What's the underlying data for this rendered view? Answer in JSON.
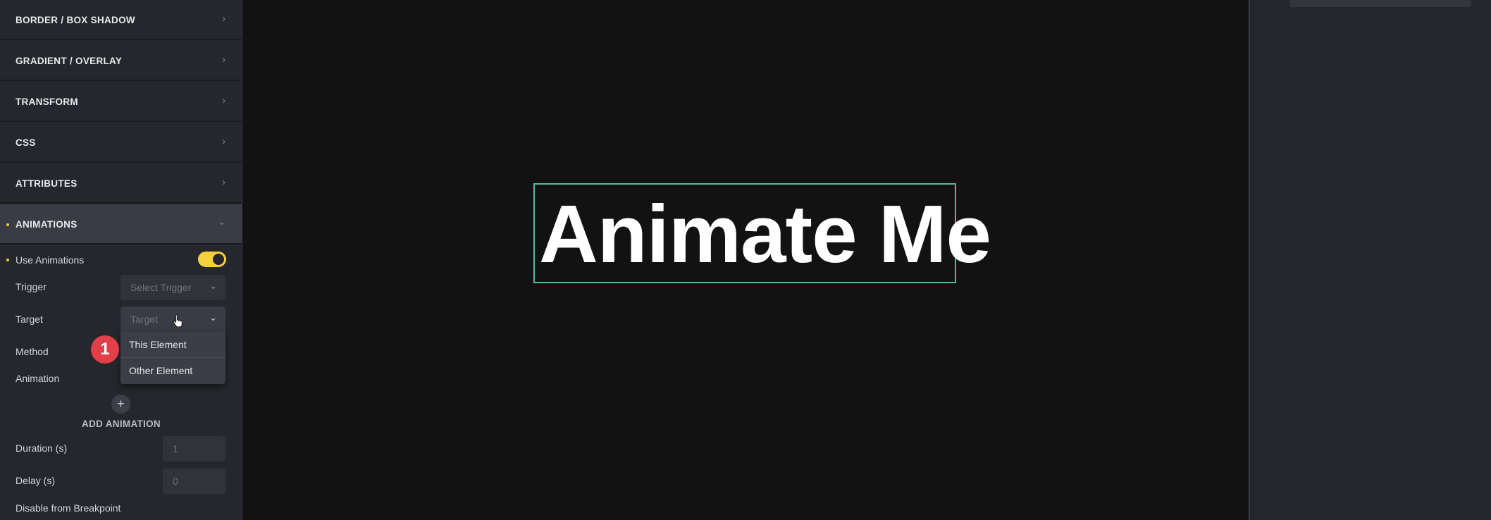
{
  "left_panel": {
    "sections": [
      {
        "label": "BORDER / BOX SHADOW",
        "icon": "chevron-right-icon"
      },
      {
        "label": "GRADIENT / OVERLAY",
        "icon": "chevron-right-icon"
      },
      {
        "label": "TRANSFORM",
        "icon": "chevron-right-icon"
      },
      {
        "label": "CSS",
        "icon": "chevron-right-icon"
      },
      {
        "label": "ATTRIBUTES",
        "icon": "chevron-right-icon"
      },
      {
        "label": "ANIMATIONS",
        "icon": "chevron-down-icon"
      }
    ],
    "animations": {
      "use_animations_label": "Use Animations",
      "use_animations_enabled": true,
      "trigger_label": "Trigger",
      "trigger_placeholder": "Select Trigger",
      "target_label": "Target",
      "target_placeholder": "Target",
      "target_options": [
        "This Element",
        "Other Element"
      ],
      "method_label": "Method",
      "animation_label": "Animation",
      "add_animation_label": "ADD ANIMATION",
      "duration_label": "Duration (s)",
      "duration_placeholder": "1",
      "delay_label": "Delay (s)",
      "delay_placeholder": "0",
      "disable_label": "Disable from Breakpoint"
    },
    "step_badge": "1"
  },
  "canvas": {
    "heading": "Animate Me"
  },
  "colors": {
    "accent_yellow": "#f4d03f",
    "selection_outline": "#5eb59f",
    "badge_red": "#e23f4a"
  }
}
